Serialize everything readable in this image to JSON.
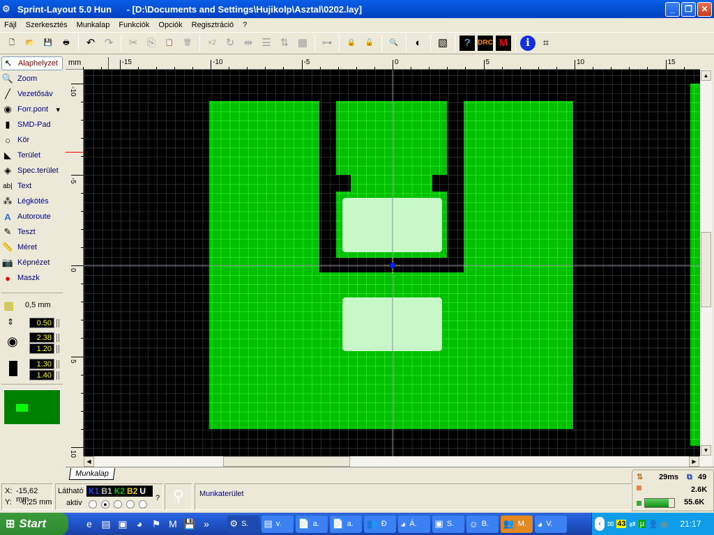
{
  "window": {
    "title": "Sprint-Layout 5.0 Hun      - [D:\\Documents and Settings\\Hujikolp\\Asztal\\0202.lay]",
    "minimize": "_",
    "maximize": "❐",
    "close": "✕"
  },
  "menu": [
    "Fájl",
    "Szerkesztés",
    "Munkalap",
    "Funkciók",
    "Opciók",
    "Regisztráció",
    "?"
  ],
  "toolbar": [
    {
      "icon": "new-file-icon",
      "g": "🗋"
    },
    {
      "icon": "open-folder-icon",
      "g": "📂"
    },
    {
      "icon": "save-icon",
      "g": "💾"
    },
    {
      "icon": "print-icon",
      "g": "🖶"
    },
    "sep",
    {
      "icon": "undo-icon",
      "g": "↶"
    },
    {
      "icon": "redo-icon",
      "g": "↷",
      "dis": true
    },
    "sep",
    {
      "icon": "cut-icon",
      "g": "✂",
      "dis": true
    },
    {
      "icon": "copy-icon",
      "g": "⎘",
      "dis": true
    },
    {
      "icon": "paste-icon",
      "g": "📋"
    },
    {
      "icon": "delete-icon",
      "g": "🗑",
      "dis": true
    },
    "sep",
    {
      "icon": "duplicate-x2-icon",
      "g": "×2",
      "dis": true
    },
    {
      "icon": "rotate-icon",
      "g": "↻",
      "dis": true
    },
    {
      "icon": "mirror-h-icon",
      "g": "⇹",
      "dis": true
    },
    {
      "icon": "align-icon",
      "g": "☰",
      "dis": true
    },
    {
      "icon": "flip-icon",
      "g": "⇅",
      "dis": true
    },
    {
      "icon": "group-icon",
      "g": "▦",
      "dis": true
    },
    "sep",
    {
      "icon": "connect-icon",
      "g": "⊶",
      "dis": true
    },
    "sep",
    {
      "icon": "lock-icon",
      "g": "🔒",
      "dis": true
    },
    {
      "icon": "unlock-icon",
      "g": "🔓",
      "dis": true
    },
    "sep",
    {
      "icon": "zoom-icon",
      "g": "🔍"
    },
    "sep",
    {
      "icon": "contrast-icon",
      "g": "◐"
    },
    "sep",
    {
      "icon": "autoroute-layer-icon",
      "g": "▧"
    },
    "sep",
    {
      "icon": "info-check-icon",
      "g": "?"
    },
    {
      "icon": "drc-icon",
      "g": "DRC"
    },
    {
      "icon": "macro-icon",
      "g": "M"
    },
    "sep",
    {
      "icon": "info-icon",
      "g": "ℹ"
    },
    {
      "icon": "crop-icon",
      "g": "⌗"
    }
  ],
  "tools": [
    {
      "label": "Alaphelyzet",
      "icon": "cursor-arrow-icon",
      "g": "↖",
      "selected": true
    },
    {
      "label": "Zoom",
      "icon": "zoom-icon",
      "g": "🔍"
    },
    {
      "label": "Vezetősáv",
      "icon": "track-icon",
      "g": "╱"
    },
    {
      "label": "Forr.pont",
      "icon": "solder-pad-icon",
      "g": "◉",
      "dropdown": "▾"
    },
    {
      "label": "SMD-Pad",
      "icon": "smd-pad-icon",
      "g": "▮"
    },
    {
      "label": "Kör",
      "icon": "circle-icon",
      "g": "○"
    },
    {
      "label": "Terület",
      "icon": "area-icon",
      "g": "◣"
    },
    {
      "label": "Spec.terület",
      "icon": "special-area-icon",
      "g": "◈"
    },
    {
      "label": "Text",
      "icon": "text-icon",
      "g": "ab|"
    },
    {
      "label": "Légkötés",
      "icon": "airwire-icon",
      "g": "⁂"
    },
    {
      "label": "Autoroute",
      "icon": "autoroute-icon",
      "g": "A"
    },
    {
      "label": "Teszt",
      "icon": "test-probe-icon",
      "g": "✎"
    },
    {
      "label": "Méret",
      "icon": "ruler-icon",
      "g": "📏"
    },
    {
      "label": "Képnézet",
      "icon": "camera-icon",
      "g": "📷"
    },
    {
      "label": "Maszk",
      "icon": "mask-icon",
      "g": "●"
    }
  ],
  "grid": {
    "label": "0,5 mm"
  },
  "params": {
    "track_width": "0.50",
    "pad_outer": "2.38",
    "pad_inner": "1.20",
    "smd_width": "1.30",
    "smd_height": "1.40"
  },
  "ruler": {
    "unit": "mm",
    "x_labels": [
      "-15",
      "-10",
      "-5",
      "0",
      "5",
      "10",
      "15"
    ],
    "y_labels": [
      "-10",
      "-5",
      "0",
      "5",
      "10"
    ]
  },
  "colors": {
    "copper": "#00c000",
    "copper_grid": "#44ff44",
    "pad": "#c8f8c8",
    "background": "#000000",
    "grid": "#505050"
  },
  "tab": {
    "label": "Munkalap"
  },
  "status": {
    "x_label": "X:",
    "x_value": "-15,62 mm",
    "y_label": "Y:",
    "y_value": "-6,25 mm",
    "visible_label": "Látható",
    "active_label": "aktiv",
    "layers": [
      {
        "name": "K1",
        "color": "#2040ff"
      },
      {
        "name": "B1",
        "color": "#c0c0c0"
      },
      {
        "name": "K2",
        "color": "#00c000"
      },
      {
        "name": "B2",
        "color": "#e8d000"
      },
      {
        "name": "U",
        "color": "#ffffff"
      }
    ],
    "active_layer": 1,
    "help": "?",
    "message": "Munkaterület"
  },
  "perf": {
    "ping": "29ms",
    "count": "49",
    "up": "2.6K",
    "down": "55.6K",
    "down_level": 0.8
  },
  "taskbar": {
    "start": "Start",
    "quicklaunch": [
      {
        "icon": "ie-icon",
        "g": "e"
      },
      {
        "icon": "notepad-icon",
        "g": "▤"
      },
      {
        "icon": "computer-icon",
        "g": "▣"
      },
      {
        "icon": "firefox-icon",
        "g": "◕"
      },
      {
        "icon": "flag-icon",
        "g": "⚑"
      },
      {
        "icon": "app-icon",
        "g": "M"
      },
      {
        "icon": "floppy-icon",
        "g": "💾"
      }
    ],
    "more": "»",
    "tasks": [
      {
        "label": "S.",
        "icon": "sprint-layout-icon",
        "g": "⚙",
        "state": "pressed"
      },
      {
        "label": "v.",
        "icon": "winrar-icon",
        "g": "▤"
      },
      {
        "label": "a.",
        "icon": "pdf-icon",
        "g": "📄"
      },
      {
        "label": "a.",
        "icon": "pdf-icon",
        "g": "📄"
      },
      {
        "label": "Đ",
        "icon": "messenger-icon",
        "g": "👥"
      },
      {
        "label": "Á.",
        "icon": "firefox-icon",
        "g": "◕"
      },
      {
        "label": "S.",
        "icon": "computer-icon",
        "g": "▣"
      },
      {
        "label": "B.",
        "icon": "chat-icon",
        "g": "☺"
      },
      {
        "label": "M.",
        "icon": "messenger-icon",
        "g": "👥",
        "state": "active"
      },
      {
        "label": "V.",
        "icon": "firefox-icon",
        "g": "◕"
      }
    ],
    "tray_badge": "43",
    "clock": "21:17"
  }
}
